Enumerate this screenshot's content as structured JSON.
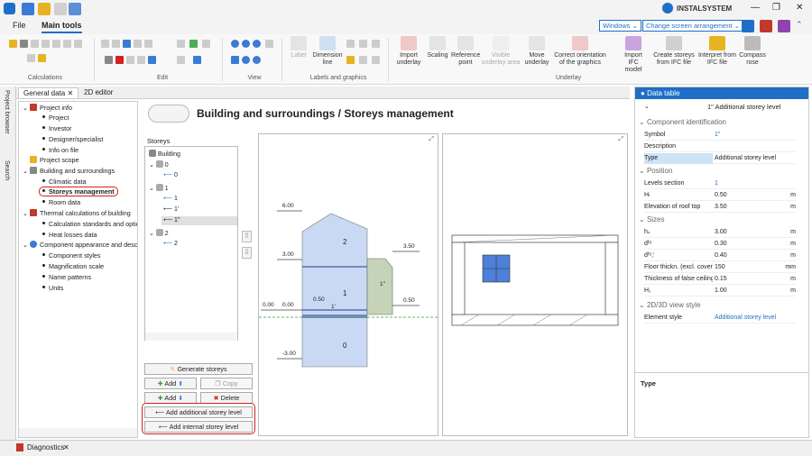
{
  "title_bar": {
    "brand": "INSTALSYSTEM",
    "min": "—",
    "restore": "❐",
    "close": "✕"
  },
  "menu": {
    "file": "File",
    "main_tools": "Main tools",
    "windows": "Windows",
    "change_screen": "Change screen arrangement"
  },
  "ribbon": {
    "groups": [
      "Calculations",
      "Edit",
      "View",
      "Labels and graphics",
      "Underlay"
    ],
    "label": "Label",
    "dimension_line": "Dimension line",
    "import_underlay": "Import underlay",
    "scaling": "Scaling",
    "reference_point": "Reference point",
    "visible_underlay_area": "Visible underlay area",
    "move_underlay": "Move underlay",
    "correct_orientation": "Correct orientation of the graphics",
    "import_ifc": "Import IFC model",
    "create_storeys": "Create storeys from IFC file",
    "interpret": "Interpret from IFC file",
    "compass": "Compass rose"
  },
  "left_strip": {
    "project_browser": "Project browser",
    "search": "Search"
  },
  "tabs": [
    {
      "label": "General data"
    },
    {
      "label": "2D editor"
    }
  ],
  "tree": {
    "project_info": "Project info",
    "project": "Project",
    "investor": "Investor",
    "designer": "Designer/specialist",
    "info_on_file": "Info on file",
    "project_scope": "Project scope",
    "building": "Building and surroundings",
    "climatic": "Climatic data",
    "storeys_mgmt": "Storeys management",
    "room_data": "Room data",
    "thermal": "Thermal calculations of building",
    "calc_standards": "Calculation standards and options",
    "heat_losses": "Heat losses data",
    "component": "Component appearance and description",
    "component_styles": "Component styles",
    "magnification": "Magnification scale",
    "name_patterns": "Name patterns",
    "units": "Units"
  },
  "content": {
    "page_title": "Building and surroundings / Storeys management",
    "storeys_label": "Storeys",
    "storeys_tree": {
      "building": "Building",
      "s0": "0",
      "s0a": "0",
      "s1": "1",
      "s1a": "1",
      "s1b": "1'",
      "s1c": "1''",
      "s2": "2",
      "s2a": "2"
    },
    "buttons": {
      "generate": "Generate storeys",
      "add_up": "Add",
      "copy": "Copy",
      "add_down": "Add",
      "delete": "Delete",
      "add_additional": "Add additional storey level",
      "add_internal": "Add internal storey level"
    },
    "drawing": {
      "levels": [
        "6.00",
        "3.00",
        "0.00",
        "0.00",
        "-3.00",
        "0.50",
        "3.50",
        "0.50"
      ],
      "storeys": [
        "2",
        "1",
        "0",
        "1'",
        "1''"
      ]
    }
  },
  "data_table": {
    "header": "Data table",
    "subtitle": "1\" Additional storey level",
    "sections": {
      "component": "Component identification",
      "position": "Position",
      "sizes": "Sizes",
      "view": "2D/3D view style"
    },
    "rows": {
      "symbol": {
        "k": "Symbol",
        "v": "1\"",
        "u": ""
      },
      "description": {
        "k": "Description",
        "v": "",
        "u": ""
      },
      "type": {
        "k": "Type",
        "v": "Additional storey level",
        "u": ""
      },
      "levels": {
        "k": "Levels section",
        "v": "1",
        "u": ""
      },
      "hl": {
        "k": "Hₗ",
        "v": "0.50",
        "u": "m"
      },
      "roof": {
        "k": "Elevation of roof top",
        "v": "3.50",
        "u": "m"
      },
      "hs": {
        "k": "hₛ",
        "v": "3.00",
        "u": "m"
      },
      "dfo": {
        "k": "dᶠᵒ",
        "v": "0.30",
        "u": "m"
      },
      "dfoi": {
        "k": "dᶠᵒ,ⁱ",
        "v": "0.40",
        "u": "m"
      },
      "floor": {
        "k": "Floor thickn. (excl. covering)",
        "v": "150",
        "u": "mm"
      },
      "false_ceiling": {
        "k": "Thickness of false ceiling",
        "v": "0.15",
        "u": "m"
      },
      "h1": {
        "k": "H₁",
        "v": "1.00",
        "u": "m"
      },
      "element_style": {
        "k": "Element style",
        "v": "Additional storey level",
        "u": ""
      }
    },
    "footer_label": "Type"
  },
  "status": {
    "diagnostics": "Diagnostics"
  }
}
